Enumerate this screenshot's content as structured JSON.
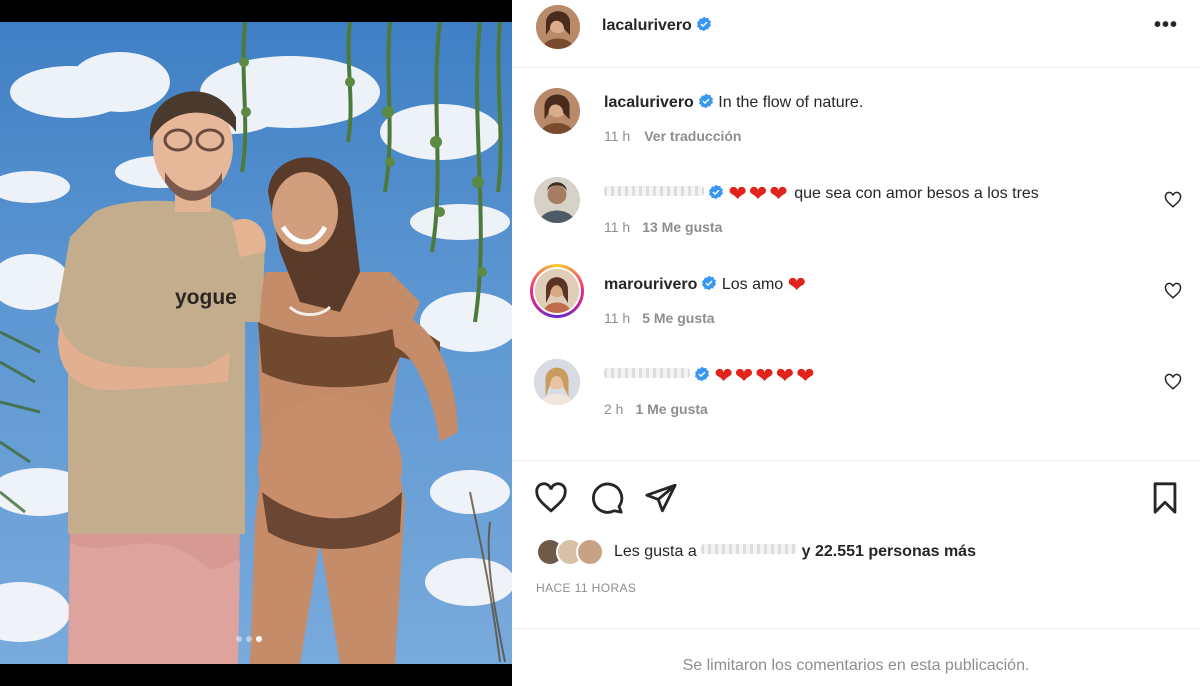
{
  "post": {
    "author": "lacalurivero",
    "caption": "In the flow of nature.",
    "caption_time": "11 h",
    "translate_label": "Ver traducción",
    "shirt_print": "yogue",
    "carousel": {
      "count": 3,
      "active": 3
    }
  },
  "comments": [
    {
      "user": "",
      "hearts": "❤❤❤",
      "text": "que sea con amor besos a los tres",
      "time": "11 h",
      "likes": "13 Me gusta",
      "verified": true
    },
    {
      "user": "marourivero",
      "hearts": "",
      "text": "Los amo",
      "trailing_hearts": "❤",
      "time": "11 h",
      "likes": "5 Me gusta",
      "verified": true
    },
    {
      "user": "",
      "hearts": "❤❤❤❤❤",
      "text": "",
      "time": "2 h",
      "likes": "1 Me gusta",
      "verified": true
    }
  ],
  "likes": {
    "prefix": "Les gusta a",
    "suffix": "y 22.551 personas más"
  },
  "timestamp": "HACE 11 HORAS",
  "comments_limited": "Se limitaron los comentarios en esta publicación.",
  "icons": {
    "more": "more-options-icon",
    "like": "heart-outline-icon",
    "comment": "comment-icon",
    "share": "share-icon",
    "save": "bookmark-icon",
    "verified": "verified-badge-icon"
  },
  "colors": {
    "verified": "#3897f0",
    "heart": "#e0241b",
    "muted": "#8e8e8e"
  }
}
